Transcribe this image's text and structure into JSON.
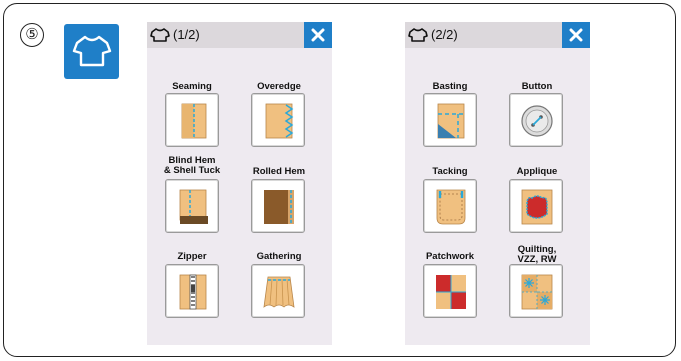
{
  "step_marker": "⑤",
  "mode_icon": {
    "name": "shirt-icon",
    "color": "#1f7fc8"
  },
  "panels": [
    {
      "page_label": "(1/2)",
      "items": [
        {
          "label": "Seaming"
        },
        {
          "label": "Overedge"
        },
        {
          "label": "Blind Hem\n& Shell Tuck"
        },
        {
          "label": "Rolled Hem"
        },
        {
          "label": "Zipper"
        },
        {
          "label": "Gathering"
        }
      ]
    },
    {
      "page_label": "(2/2)",
      "items": [
        {
          "label": "Basting"
        },
        {
          "label": "Button"
        },
        {
          "label": "Tacking"
        },
        {
          "label": "Applique"
        },
        {
          "label": "Patchwork"
        },
        {
          "label": "Quilting,\nVZZ, RW"
        }
      ]
    }
  ],
  "colors": {
    "accent": "#1f7fc8",
    "fabric": "#f0c080",
    "stitch": "#2aa8d8"
  }
}
